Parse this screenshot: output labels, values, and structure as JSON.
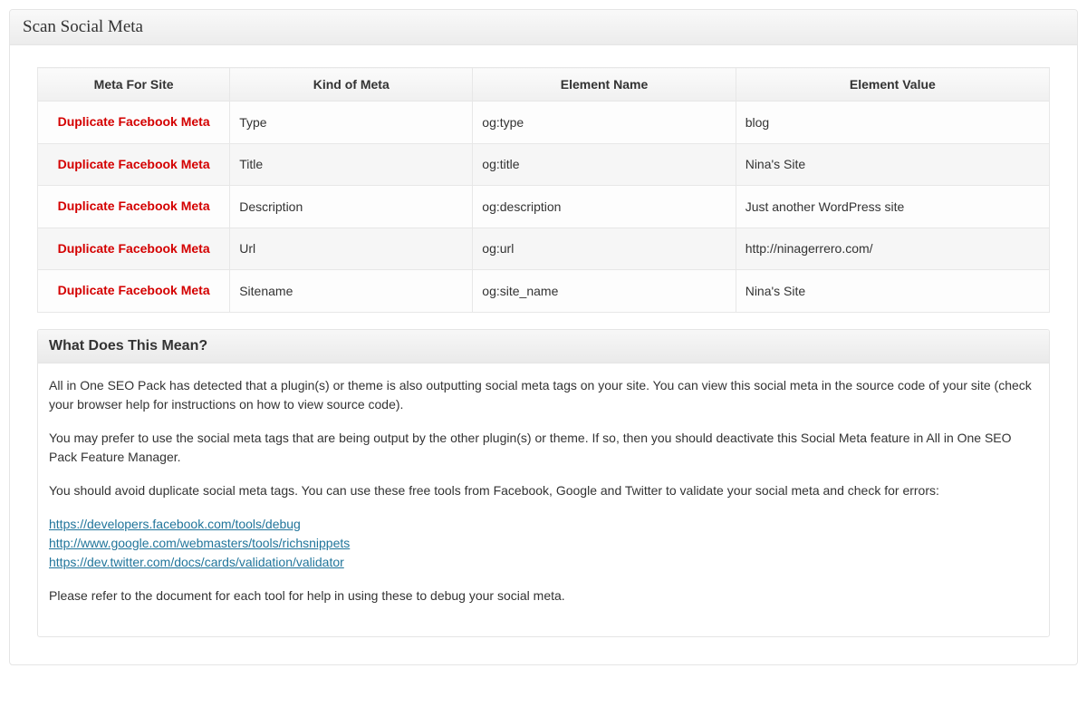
{
  "panel": {
    "title": "Scan Social Meta"
  },
  "table": {
    "headers": {
      "meta_for_site": "Meta For Site",
      "kind_of_meta": "Kind of Meta",
      "element_name": "Element Name",
      "element_value": "Element Value"
    },
    "rows": [
      {
        "site": "Duplicate Facebook Meta",
        "kind": "Type",
        "elname": "og:type",
        "elvalue": "blog"
      },
      {
        "site": "Duplicate Facebook Meta",
        "kind": "Title",
        "elname": "og:title",
        "elvalue": "Nina's Site"
      },
      {
        "site": "Duplicate Facebook Meta",
        "kind": "Description",
        "elname": "og:description",
        "elvalue": "Just another WordPress site"
      },
      {
        "site": "Duplicate Facebook Meta",
        "kind": "Url",
        "elname": "og:url",
        "elvalue": "http://ninagerrero.com/"
      },
      {
        "site": "Duplicate Facebook Meta",
        "kind": "Sitename",
        "elname": "og:site_name",
        "elvalue": "Nina's Site"
      }
    ]
  },
  "info": {
    "heading": "What Does This Mean?",
    "para1": "All in One SEO Pack has detected that a plugin(s) or theme is also outputting social meta tags on your site.  You can view this social meta in the source code of your site (check your browser help for instructions on how to view source code).",
    "para2": "You may prefer to use the social meta tags that are being output by the other plugin(s) or theme.  If so, then you should deactivate this Social Meta feature in All in One SEO Pack Feature Manager.",
    "para3": "You should avoid duplicate social meta tags.  You can use these free tools from Facebook, Google and Twitter to validate your social meta and check for errors:",
    "links": [
      "https://developers.facebook.com/tools/debug",
      "http://www.google.com/webmasters/tools/richsnippets",
      "https://dev.twitter.com/docs/cards/validation/validator"
    ],
    "para4": "Please refer to the document for each tool for help in using these to debug your social meta."
  }
}
